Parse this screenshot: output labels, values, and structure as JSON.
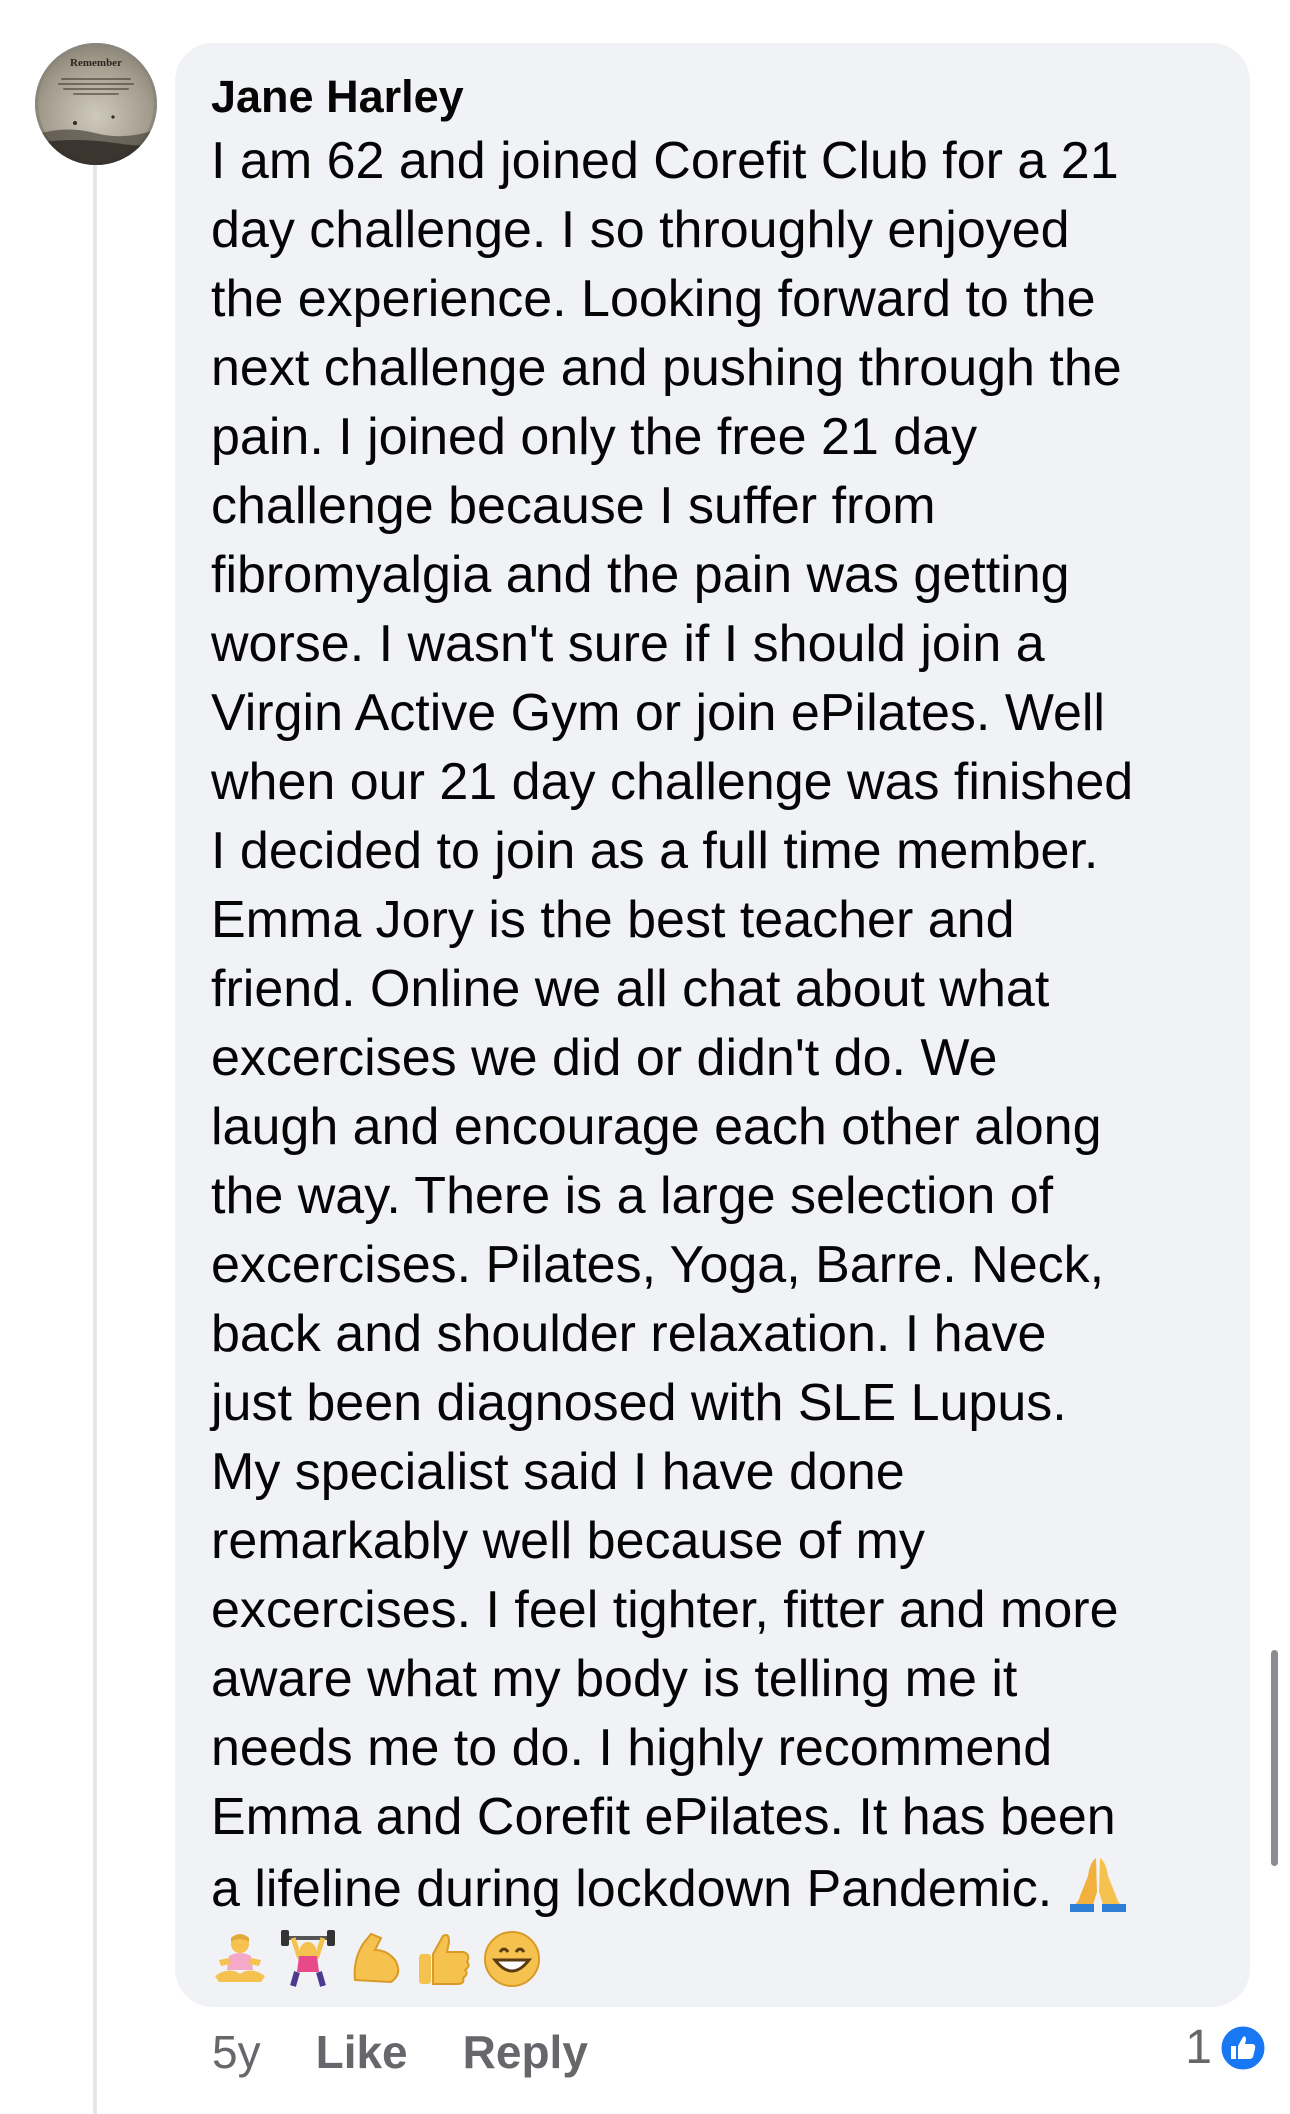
{
  "comment": {
    "author": "Jane Harley",
    "avatar_text": "Remember",
    "lines": [
      "I am 62 and joined Corefit Club for a 21",
      "day challenge. I so throughly enjoyed",
      "the experience. Looking forward to the",
      "next challenge and pushing through the",
      "pain. I joined only the free 21 day",
      "challenge because I suffer from",
      "fibromyalgia and the pain was getting",
      "worse. I wasn't sure if I should join a",
      "Virgin Active Gym or join ePilates. Well",
      "when our 21 day challenge was finished",
      "I decided to join as a full time member.",
      "Emma Jory is the best teacher and",
      "friend. Online we all chat about what",
      "excercises we did or didn't do. We",
      "laugh and encourage each other  along",
      "the way. There is a large selection of",
      "excercises. Pilates,  Yoga, Barre. Neck,",
      "back and shoulder relaxation. I have",
      "just been diagnosed with SLE Lupus.",
      "My specialist said I have done",
      "remarkably well because of my",
      "excercises. I feel tighter, fitter and more",
      "aware what my body is telling me it",
      "needs me to do. I highly recommend",
      "Emma and Corefit ePilates. It has been",
      "a lifeline during lockdown Pandemic."
    ],
    "emojis": [
      "praying-hands-icon",
      "person-lotus-icon",
      "weight-lifter-icon",
      "flexed-biceps-icon",
      "thumbs-up-icon",
      "grinning-face-icon"
    ]
  },
  "actions": {
    "time": "5y",
    "like_label": "Like",
    "reply_label": "Reply"
  },
  "reactions": {
    "count": "1",
    "type": "like"
  },
  "colors": {
    "bubble": "#f0f2f5",
    "meta_text": "#65676b",
    "like_blue": "#1877f2",
    "thread_line": "#e4e6eb"
  }
}
